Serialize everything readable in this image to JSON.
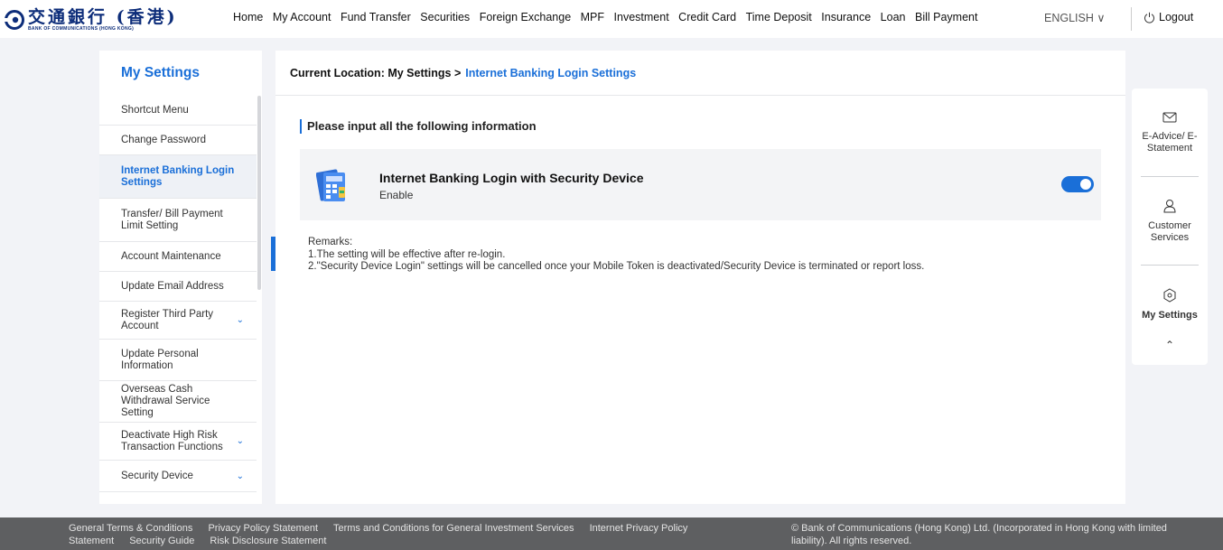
{
  "brand": {
    "cn": "交通銀行 (香港)",
    "en": "BANK OF COMMUNICATIONS (HONG KONG)"
  },
  "nav": [
    "Home",
    "My Account",
    "Fund Transfer",
    "Securities",
    "Foreign Exchange",
    "MPF",
    "Investment",
    "Credit Card",
    "Time Deposit",
    "Insurance",
    "Loan",
    "Bill Payment"
  ],
  "language": "ENGLISH ∨",
  "logout": "Logout",
  "sidebar": {
    "title": "My Settings",
    "items": [
      {
        "label": "Shortcut Menu"
      },
      {
        "label": "Change Password"
      },
      {
        "label": "Internet Banking Login Settings",
        "active": true
      },
      {
        "label": "Transfer/ Bill Payment Limit Setting"
      },
      {
        "label": "Account Maintenance"
      },
      {
        "label": "Update Email Address"
      },
      {
        "label": "Register Third Party Account",
        "expand": true
      },
      {
        "label": "Update Personal Information"
      },
      {
        "label": "Overseas Cash Withdrawal Service Setting"
      },
      {
        "label": "Deactivate High Risk Transaction Functions",
        "expand": true
      },
      {
        "label": "Security Device",
        "expand": true
      }
    ]
  },
  "breadcrumb": {
    "prefix": "Current Location:  My Settings  >",
    "current": "Internet Banking Login Settings"
  },
  "section_title": "Please input all the following information",
  "setting": {
    "title": "Internet Banking Login with Security Device",
    "status": "Enable",
    "enabled": true
  },
  "remarks": {
    "heading": "Remarks:",
    "lines": [
      "1.The setting will be effective after re-login.",
      "2.\"Security Device Login\" settings will be cancelled once your Mobile Token is deactivated/Security Device is terminated or report loss."
    ]
  },
  "right_panel": {
    "eadvice": "E-Advice/ E-Statement",
    "customer": "Customer Services",
    "settings": "My Settings"
  },
  "footer": {
    "links": [
      "General Terms & Conditions",
      "Privacy Policy Statement",
      "Terms and Conditions for General Investment Services",
      "Internet Privacy Policy",
      "Statement",
      "Security Guide",
      "Risk Disclosure Statement"
    ],
    "copyright": "© Bank of Communications (Hong Kong) Ltd. (Incorporated in Hong Kong with limited liability). All rights reserved."
  },
  "colors": {
    "accent": "#1a6fd8",
    "brand_navy": "#0d2d7a",
    "footer_bg": "#5e5f61"
  }
}
